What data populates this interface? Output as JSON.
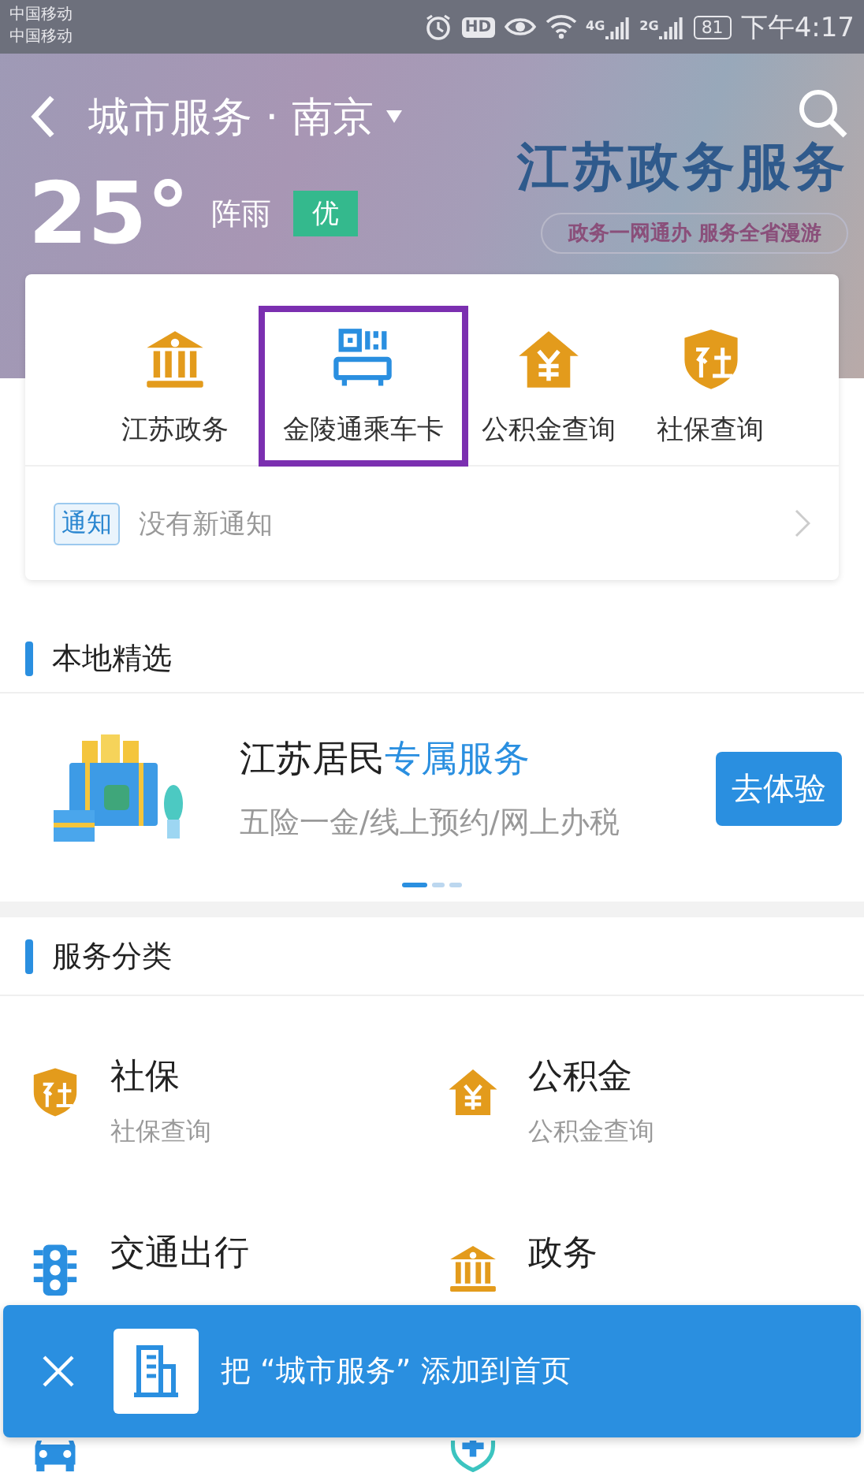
{
  "status_bar": {
    "carriers": [
      "中国移动",
      "中国移动"
    ],
    "hd": "HD",
    "networks": [
      "4G",
      "2G"
    ],
    "battery": "81",
    "time": "下午4:17"
  },
  "header": {
    "title": "城市服务 · 南京",
    "banner_title": "江苏政务服务",
    "banner_slogan": "政务一网通办  服务全省漫游"
  },
  "weather": {
    "temperature": "25°",
    "condition": "阵雨",
    "air_quality": "优"
  },
  "quick_links": [
    {
      "kind": "bank",
      "label": "江苏政务",
      "selected": false
    },
    {
      "kind": "card",
      "label": "金陵通乘车卡",
      "selected": true
    },
    {
      "kind": "house",
      "label": "公积金查询",
      "selected": false
    },
    {
      "kind": "shield",
      "label": "社保查询",
      "selected": false
    }
  ],
  "notice": {
    "tag": "通知",
    "text": "没有新通知"
  },
  "local_section": {
    "title": "本地精选"
  },
  "promo": {
    "title": "江苏居民",
    "title_highlight": "专属服务",
    "subtitle": "五险一金/线上预约/网上办税",
    "button": "去体验",
    "pages": [
      {
        "selected": true
      },
      {
        "selected": false
      },
      {
        "selected": false
      }
    ]
  },
  "services_section": {
    "title": "服务分类"
  },
  "services": [
    {
      "kind": "shield",
      "title": "社保",
      "subtitle": "社保查询"
    },
    {
      "kind": "house",
      "title": "公积金",
      "subtitle": "公积金查询"
    },
    {
      "kind": "traffic",
      "title": "交通出行"
    },
    {
      "kind": "bank",
      "title": "政务"
    },
    {
      "kind": "car"
    },
    {
      "kind": "medical"
    }
  ],
  "toast": {
    "text": "把 “城市服务” 添加到首页"
  }
}
